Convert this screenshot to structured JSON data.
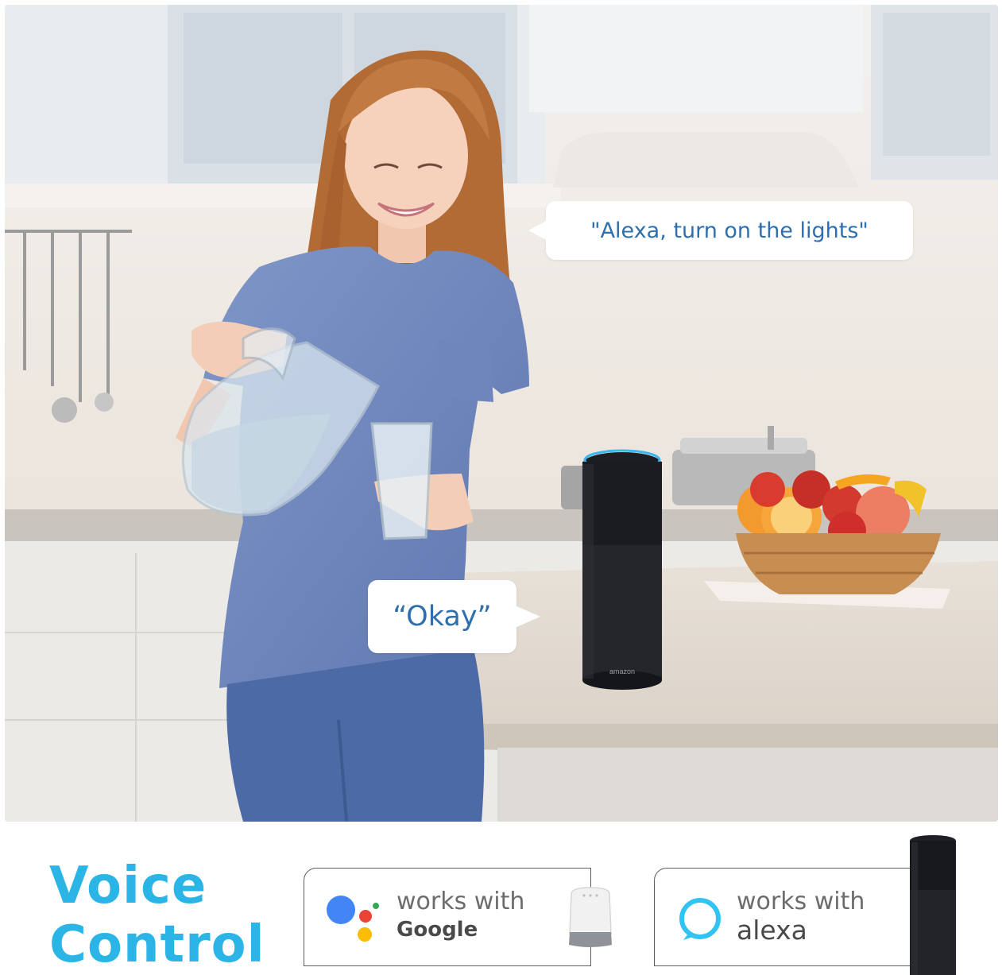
{
  "bubbles": {
    "user_command": "\"Alexa, turn on the lights\"",
    "assistant_reply": "“Okay”"
  },
  "speaker": {
    "brand_text": "amazon"
  },
  "footer": {
    "title_line1": "Voice",
    "title_line2": "Control",
    "google_badge": {
      "line1": "works with",
      "line2": "Google",
      "icon": "google-assistant-icon"
    },
    "alexa_badge": {
      "line1": "works with",
      "line2": "alexa",
      "icon": "alexa-ring-icon"
    }
  },
  "colors": {
    "accent": "#2bb5e7",
    "bubble_text": "#2f6fae",
    "google_blue": "#4285f4",
    "google_red": "#ea4335",
    "google_yellow": "#fbbc05",
    "google_green": "#34a853",
    "alexa_ring": "#31c4f3"
  }
}
